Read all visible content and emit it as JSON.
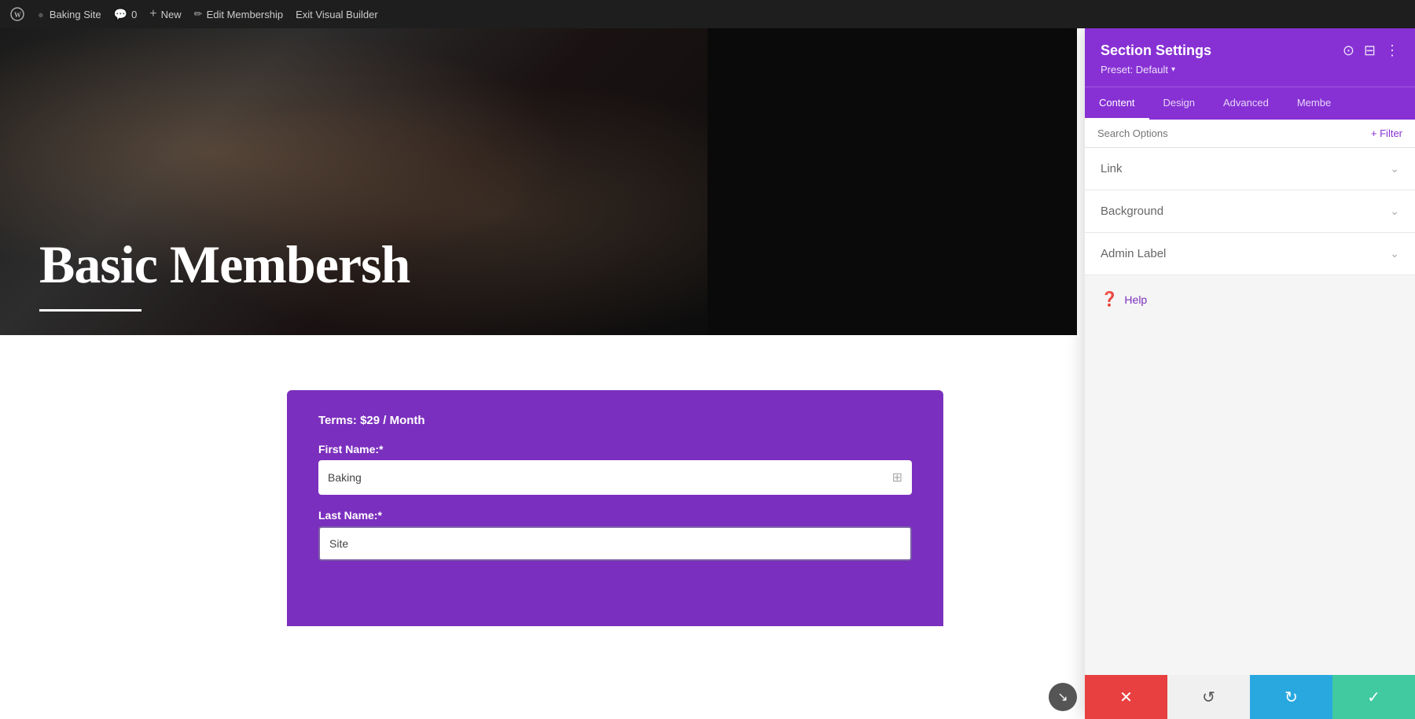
{
  "adminBar": {
    "wpLogoLabel": "W",
    "siteNameLabel": "Baking Site",
    "commentsLabel": "0",
    "newLabel": "New",
    "editLabel": "Edit Membership",
    "exitLabel": "Exit Visual Builder"
  },
  "hero": {
    "text": "Basic Membersh",
    "lineVisible": true
  },
  "form": {
    "termsLabel": "Terms: $29 / Month",
    "firstNameLabel": "First Name:*",
    "firstNameValue": "Baking",
    "lastNameLabel": "Last Name:*",
    "lastNameValue": "Site"
  },
  "panel": {
    "title": "Section Settings",
    "presetLabel": "Preset: Default",
    "presetArrow": "▾",
    "tabs": [
      {
        "id": "content",
        "label": "Content",
        "active": true
      },
      {
        "id": "design",
        "label": "Design",
        "active": false
      },
      {
        "id": "advanced",
        "label": "Advanced",
        "active": false
      },
      {
        "id": "membe",
        "label": "Membe",
        "active": false
      }
    ],
    "searchPlaceholder": "Search Options",
    "filterLabel": "+ Filter",
    "accordions": [
      {
        "id": "link",
        "label": "Link",
        "expanded": false
      },
      {
        "id": "background",
        "label": "Background",
        "expanded": false
      },
      {
        "id": "admin-label",
        "label": "Admin Label",
        "expanded": false
      }
    ],
    "helpLabel": "Help"
  },
  "actionBar": {
    "cancelIcon": "✕",
    "undoIcon": "↺",
    "redoIcon": "↻",
    "saveIcon": "✓"
  },
  "arrowBtn": {
    "icon": "↘"
  }
}
